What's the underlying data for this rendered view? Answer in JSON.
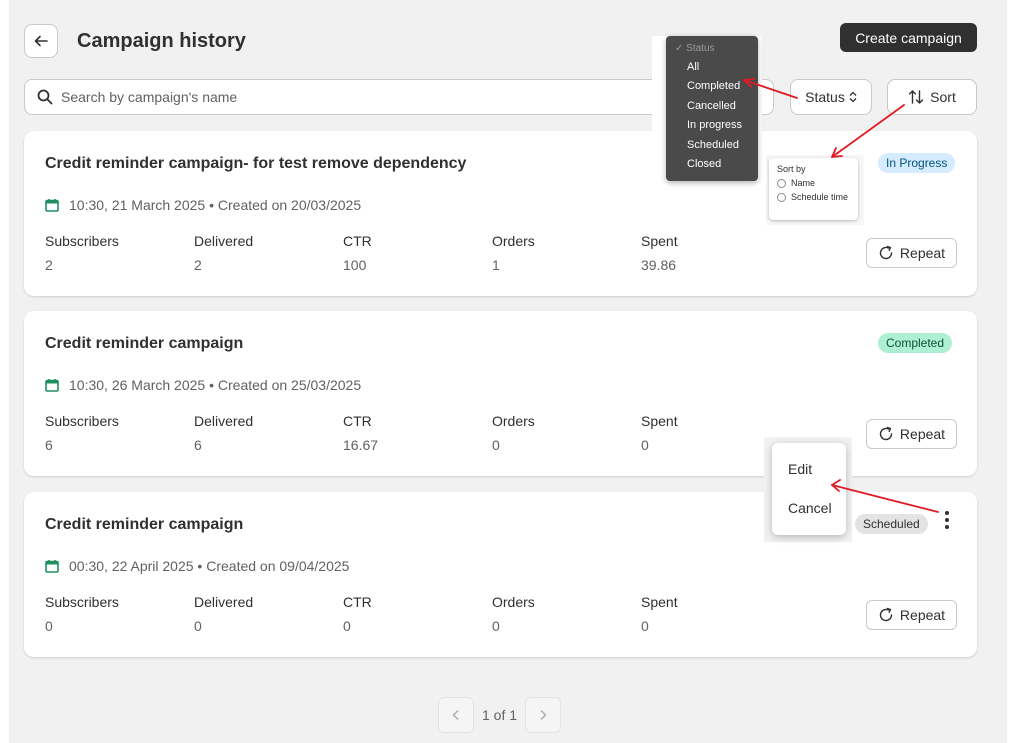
{
  "header": {
    "title": "Campaign history",
    "create_label": "Create campaign"
  },
  "toolbar": {
    "search_placeholder": "Search by campaign's name",
    "status_label": "Status",
    "sort_label": "Sort"
  },
  "status_menu": {
    "header": "Status",
    "options": [
      "All",
      "Completed",
      "Cancelled",
      "In progress",
      "Scheduled",
      "Closed"
    ]
  },
  "sort_popover": {
    "title": "Sort by",
    "options": [
      "Name",
      "Schedule time"
    ]
  },
  "context_menu": {
    "items": [
      "Edit",
      "Cancel"
    ]
  },
  "stat_labels": [
    "Subscribers",
    "Delivered",
    "CTR",
    "Orders",
    "Spent"
  ],
  "repeat_label": "Repeat",
  "campaigns": [
    {
      "title": "Credit reminder campaign- for test remove dependency",
      "date": "10:30, 21 March 2025 • Created on 20/03/2025",
      "status": "In Progress",
      "stats": [
        "2",
        "2",
        "100",
        "1",
        "39.86"
      ]
    },
    {
      "title": "Credit reminder campaign",
      "date": "10:30, 26 March 2025 • Created on 25/03/2025",
      "status": "Completed",
      "stats": [
        "6",
        "6",
        "16.67",
        "0",
        "0"
      ]
    },
    {
      "title": "Credit reminder campaign",
      "date": "00:30, 22 April 2025 • Created on 09/04/2025",
      "status": "Scheduled",
      "stats": [
        "0",
        "0",
        "0",
        "0",
        "0"
      ]
    }
  ],
  "pagination": {
    "label": "1 of 1"
  },
  "colors": {
    "badge_in_progress": "#d5ebff",
    "badge_completed": "#aff0d4",
    "badge_scheduled": "#e3e3e3",
    "calendar_icon": "#1f8f5f",
    "annotation_arrow": "#e01b24",
    "primary_button": "#303030"
  }
}
